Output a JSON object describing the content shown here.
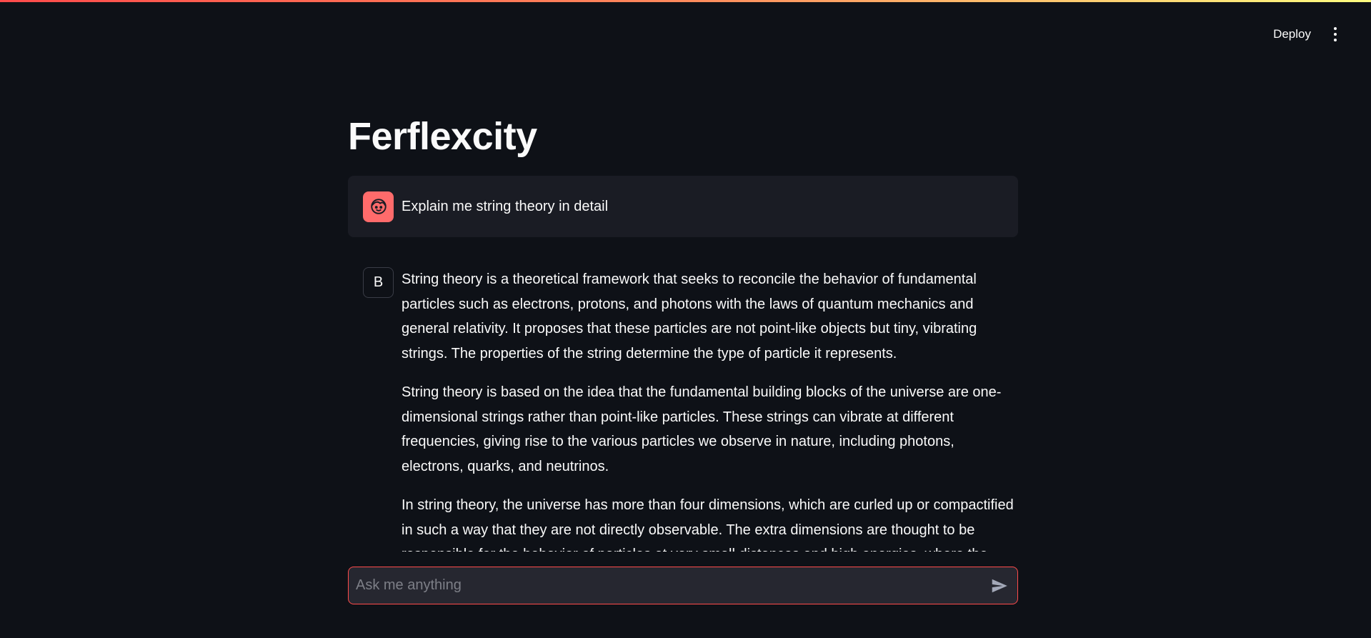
{
  "header": {
    "deploy_label": "Deploy",
    "menu_icon": "vertical-ellipsis-icon"
  },
  "page": {
    "title": "Ferflexcity"
  },
  "chat": {
    "user_message": {
      "avatar_icon": "user-face-icon",
      "avatar_color": "#ff6b6b",
      "text": "Explain me string theory in detail"
    },
    "assistant_message": {
      "avatar_letter": "B",
      "paragraphs": [
        "String theory is a theoretical framework that seeks to reconcile the behavior of fundamental particles such as electrons, protons, and photons with the laws of quantum mechanics and general relativity. It proposes that these particles are not point-like objects but tiny, vibrating strings. The properties of the string determine the type of particle it represents.",
        "String theory is based on the idea that the fundamental building blocks of the universe are one-dimensional strings rather than point-like particles. These strings can vibrate at different frequencies, giving rise to the various particles we observe in nature, including photons, electrons, quarks, and neutrinos.",
        "In string theory, the universe has more than four dimensions, which are curled up or compactified in such a way that they are not directly observable. The extra dimensions are thought to be responsible for the behavior of particles at very small distances and high energies, where the"
      ]
    }
  },
  "input": {
    "placeholder": "Ask me anything",
    "send_icon": "send-icon"
  },
  "colors": {
    "background": "#0e1117",
    "accent": "#ff4b4b",
    "message_bg": "#1a1c24",
    "input_bg": "#262730"
  }
}
